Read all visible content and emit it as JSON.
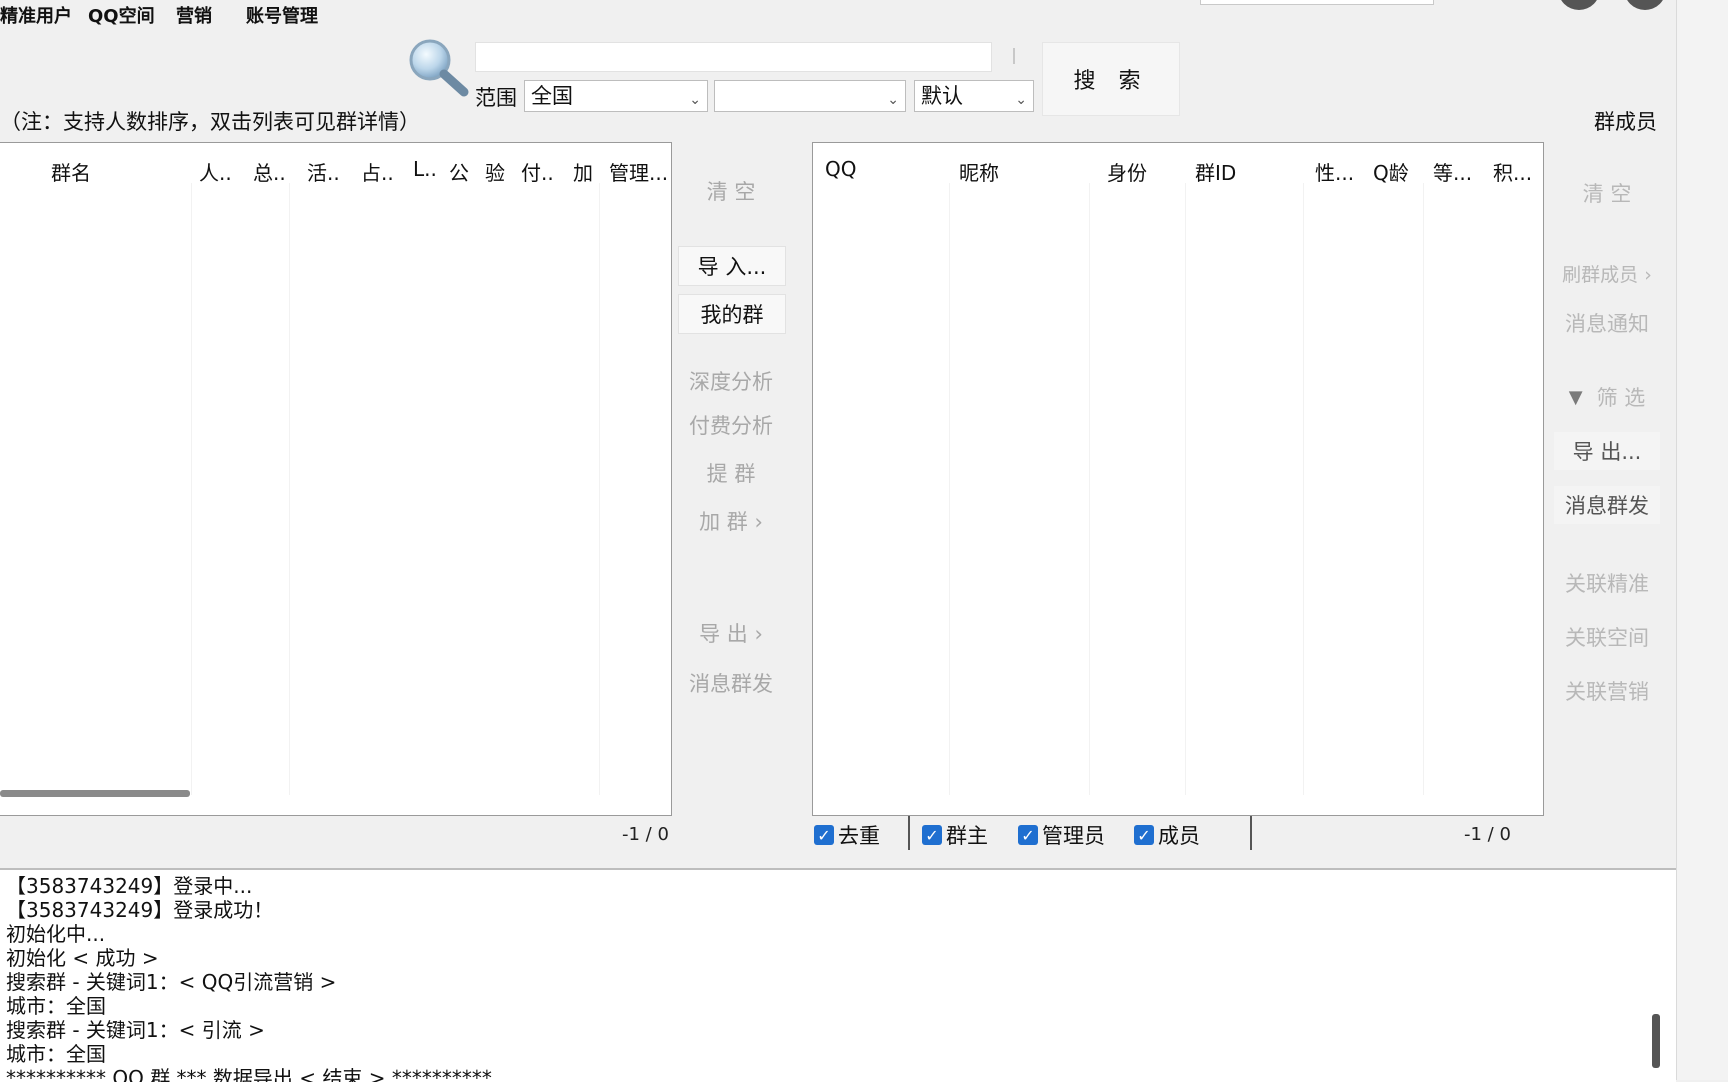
{
  "menu": {
    "items": [
      "精准用户",
      "QQ空间",
      "营销",
      "账号管理"
    ]
  },
  "search": {
    "value": "",
    "button_label": "搜 索",
    "range_label": "范围",
    "range_value": "全国",
    "second_value": "",
    "sort_value": "默认"
  },
  "note": "（注：支持人数排序，双击列表可见群详情）",
  "right_header": "群成员",
  "groups_table": {
    "columns": [
      "群名",
      "人..",
      "总..",
      "活..",
      "占..",
      "L..",
      "公",
      "验",
      "付..",
      "加",
      "管理..."
    ],
    "pager": "-1 / 0"
  },
  "middle_buttons": [
    {
      "label": "清 空",
      "enabled": false
    },
    {
      "label": "导 入...",
      "enabled": true
    },
    {
      "label": "我的群",
      "enabled": true
    },
    {
      "label": "深度分析",
      "enabled": false
    },
    {
      "label": "付费分析",
      "enabled": false
    },
    {
      "label": "提 群",
      "enabled": false
    },
    {
      "label": "加 群 ›",
      "enabled": false
    },
    {
      "label": "导 出 ›",
      "enabled": false
    },
    {
      "label": "消息群发",
      "enabled": false
    }
  ],
  "members_table": {
    "columns": [
      "QQ",
      "昵称",
      "身份",
      "群ID",
      "性...",
      "Q龄",
      "等...",
      "积..."
    ],
    "pager": "-1 / 0"
  },
  "member_filters": [
    {
      "label": "去重",
      "checked": true
    },
    {
      "label": "群主",
      "checked": true
    },
    {
      "label": "管理员",
      "checked": true
    },
    {
      "label": "成员",
      "checked": true
    }
  ],
  "right_buttons": [
    {
      "label": "清 空",
      "enabled": false
    },
    {
      "label": "刷群成员 ›",
      "enabled": false
    },
    {
      "label": "消息通知",
      "enabled": false
    },
    {
      "label": "筛 选",
      "enabled": false,
      "icon": "filter-icon"
    },
    {
      "label": "导 出...",
      "enabled": true
    },
    {
      "label": "消息群发",
      "enabled": true
    },
    {
      "label": "关联精准",
      "enabled": false
    },
    {
      "label": "关联空间",
      "enabled": false
    },
    {
      "label": "关联营销",
      "enabled": false
    }
  ],
  "log": [
    "【3583743249】登录中...",
    "【3583743249】登录成功！",
    "初始化中...",
    "初始化 < 成功 >",
    "搜索群 - 关键词1：< QQ引流营销 >",
    "城市：全国",
    "搜索群 - 关键词1：< 引流 >",
    "城市：全国",
    "********** QQ 群  ***  数据导出 < 结束 > **********"
  ]
}
